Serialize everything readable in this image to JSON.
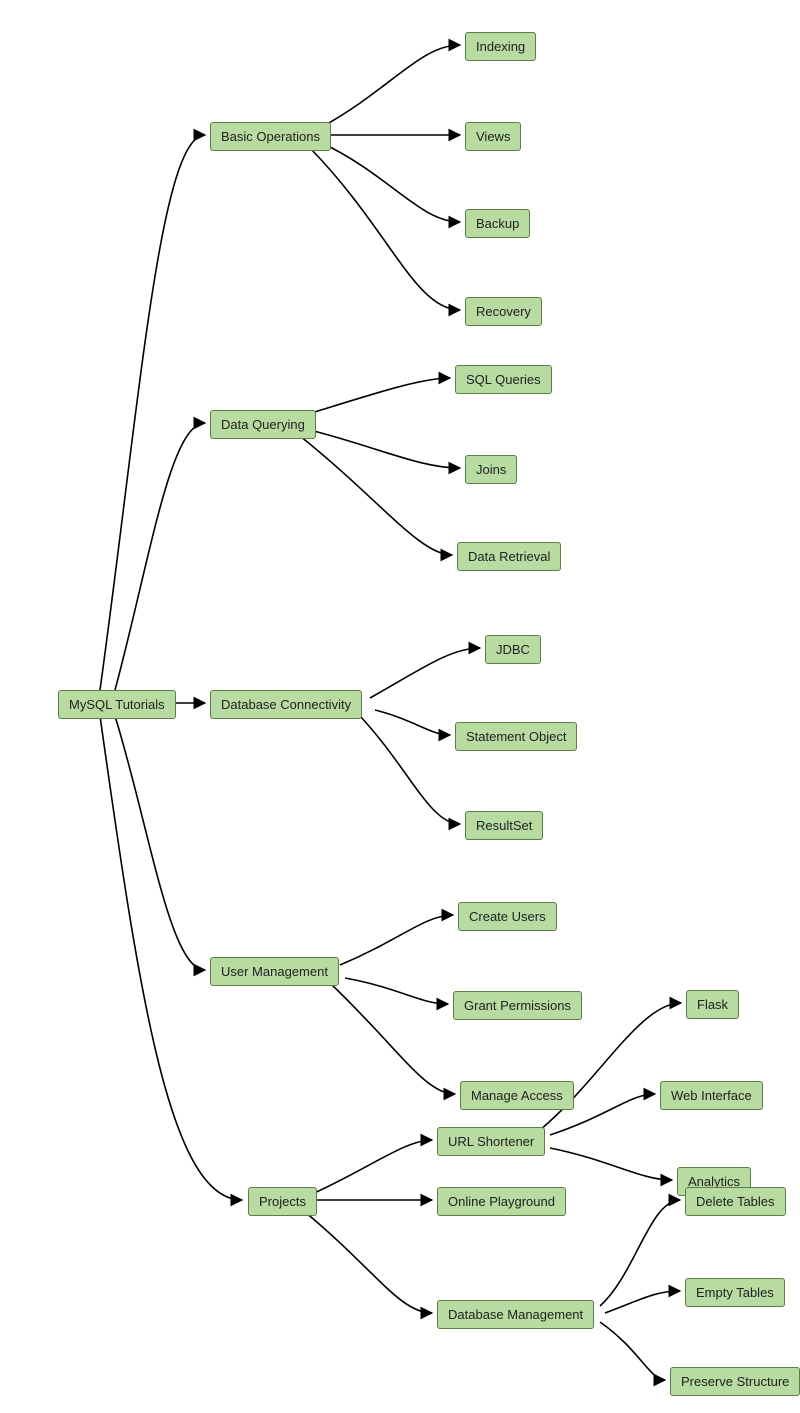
{
  "colors": {
    "node_fill": "#b7dba1",
    "node_border": "#5c7f47",
    "edge": "#000000"
  },
  "root": {
    "label": "MySQL Tutorials"
  },
  "level1": {
    "basic": {
      "label": "Basic Operations"
    },
    "query": {
      "label": "Data Querying"
    },
    "conn": {
      "label": "Database Connectivity"
    },
    "user": {
      "label": "User Management"
    },
    "proj": {
      "label": "Projects"
    }
  },
  "basic_children": {
    "a": "Indexing",
    "b": "Views",
    "c": "Backup",
    "d": "Recovery"
  },
  "query_children": {
    "a": "SQL Queries",
    "b": "Joins",
    "c": "Data Retrieval"
  },
  "conn_children": {
    "a": "JDBC",
    "b": "Statement Object",
    "c": "ResultSet"
  },
  "user_children": {
    "a": "Create Users",
    "b": "Grant Permissions",
    "c": "Manage Access"
  },
  "proj_children": {
    "a": "URL Shortener",
    "b": "Online Playground",
    "c": "Database Management"
  },
  "url_children": {
    "a": "Flask",
    "b": "Web Interface",
    "c": "Analytics"
  },
  "dbm_children": {
    "a": "Delete Tables",
    "b": "Empty Tables",
    "c": "Preserve Structure"
  }
}
